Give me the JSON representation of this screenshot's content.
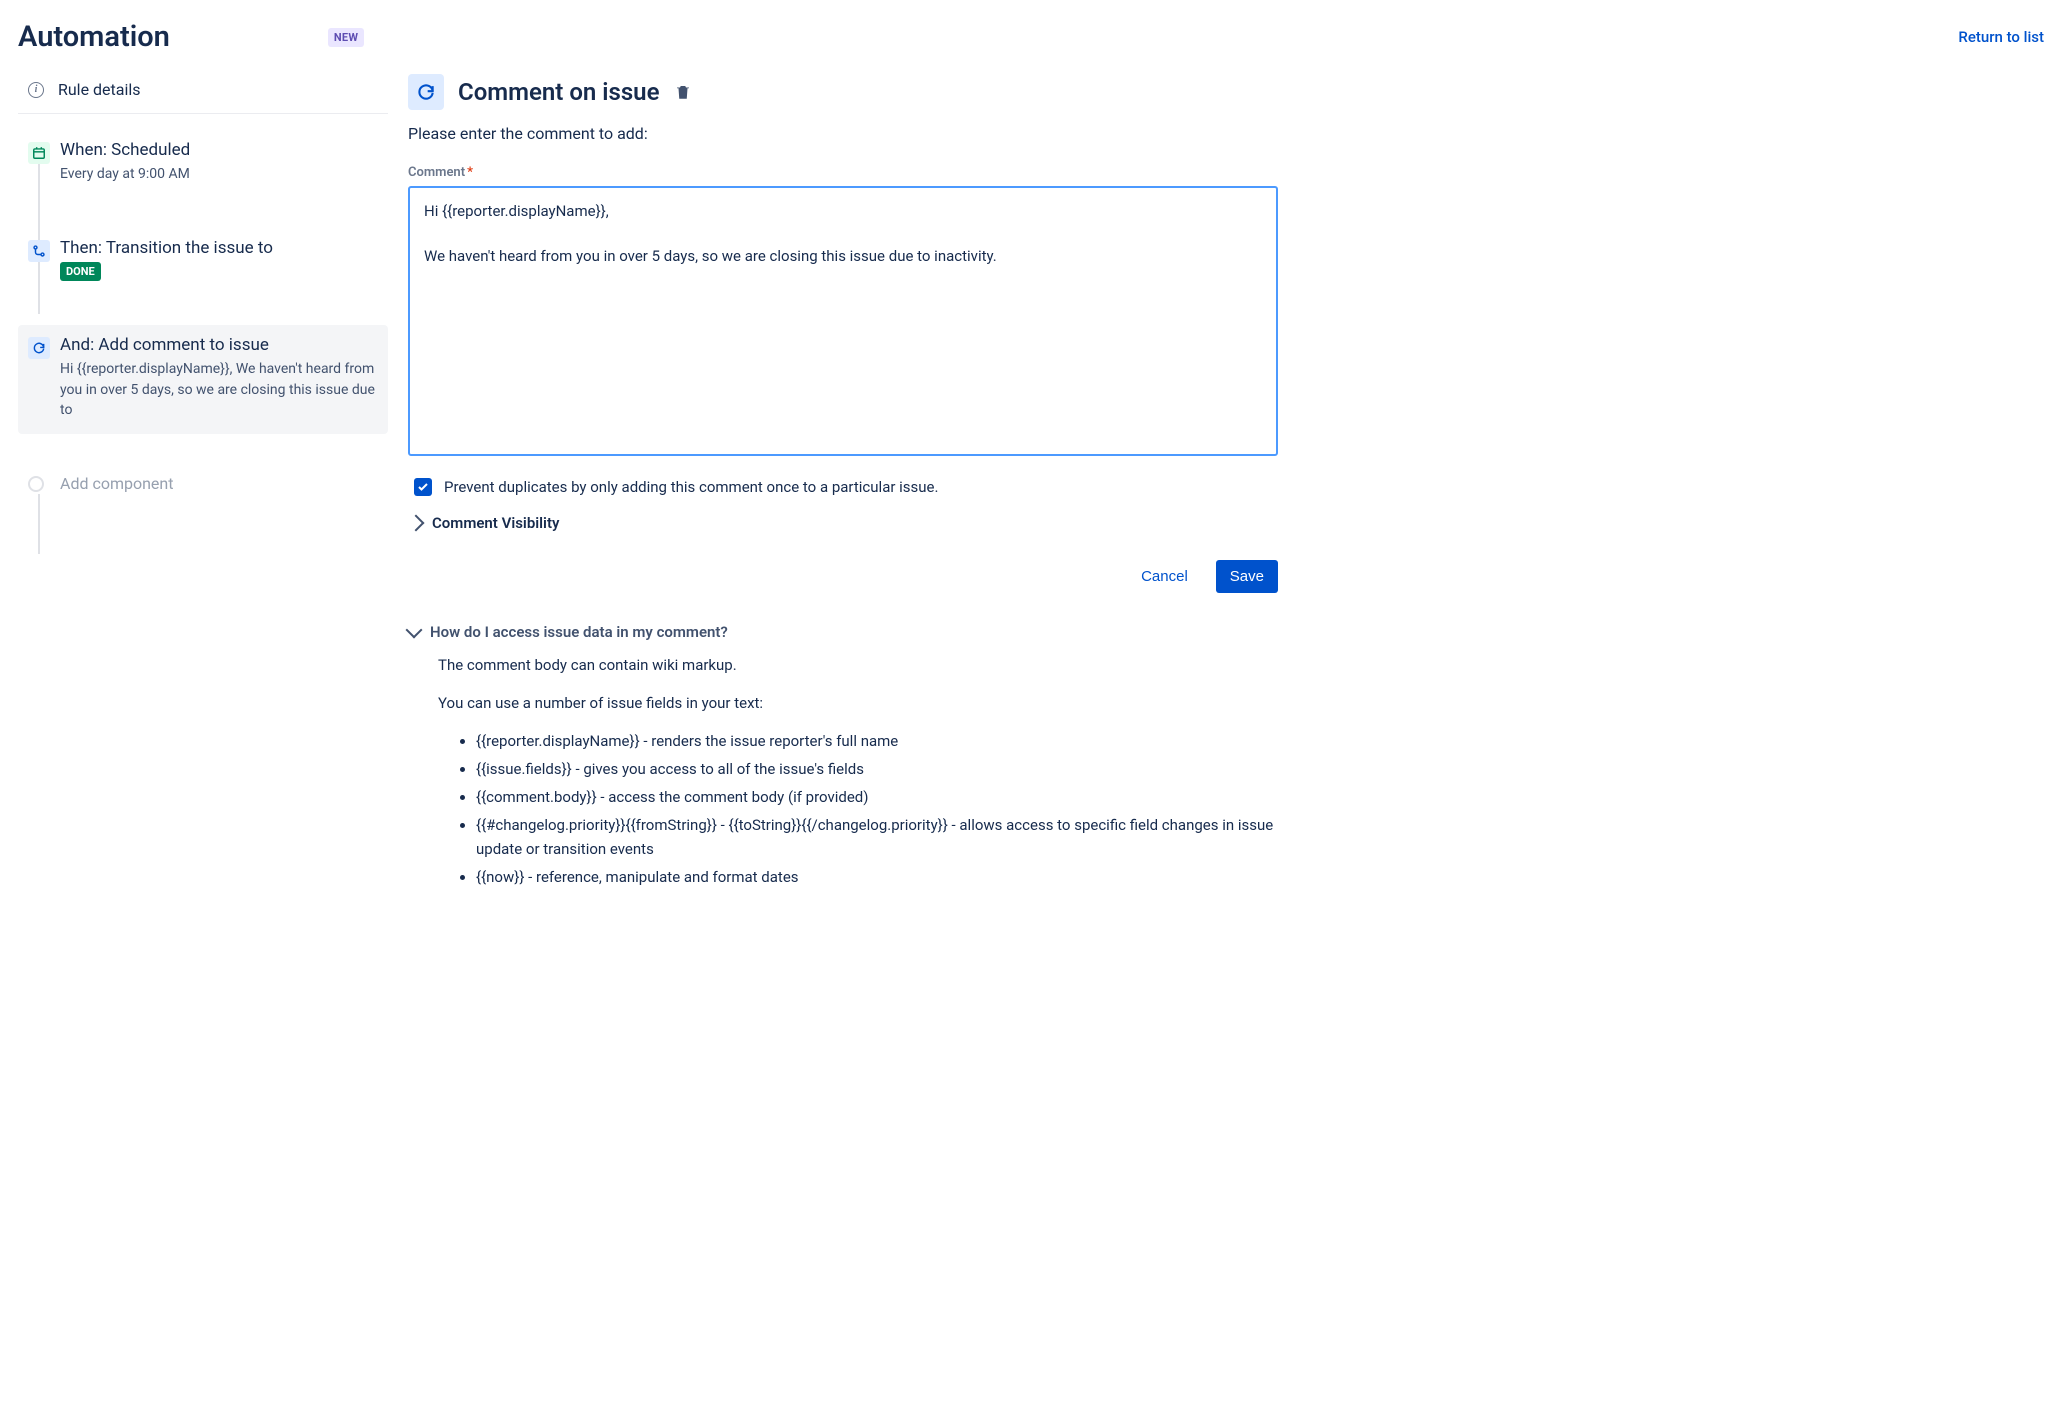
{
  "header": {
    "title": "Automation",
    "badge": "NEW",
    "return_link": "Return to list"
  },
  "sidebar": {
    "rule_details_label": "Rule details",
    "steps": [
      {
        "title": "When: Scheduled",
        "sub": "Every day at 9:00 AM"
      },
      {
        "title": "Then: Transition the issue to",
        "badge": "DONE"
      },
      {
        "title": "And: Add comment to issue",
        "sub": "Hi {{reporter.displayName}}, We haven't heard from you in over 5 days, so we are closing this issue due to"
      }
    ],
    "add_component": "Add component"
  },
  "main": {
    "title": "Comment on issue",
    "instruction": "Please enter the comment to add:",
    "comment_label": "Comment",
    "comment_value": "Hi {{reporter.displayName}},\n\nWe haven't heard from you in over 5 days, so we are closing this issue due to inactivity.",
    "prevent_duplicates": "Prevent duplicates by only adding this comment once to a particular issue.",
    "visibility_label": "Comment Visibility",
    "cancel": "Cancel",
    "save": "Save"
  },
  "help": {
    "title": "How do I access issue data in my comment?",
    "line1": "The comment body can contain wiki markup.",
    "line2": "You can use a number of issue fields in your text:",
    "items": [
      "{{reporter.displayName}} - renders the issue reporter's full name",
      "{{issue.fields}} - gives you access to all of the issue's fields",
      "{{comment.body}} - access the comment body (if provided)",
      "{{#changelog.priority}}{{fromString}} - {{toString}}{{/changelog.priority}} - allows access to specific field changes in issue update or transition events",
      "{{now}} - reference, manipulate and format dates"
    ]
  }
}
